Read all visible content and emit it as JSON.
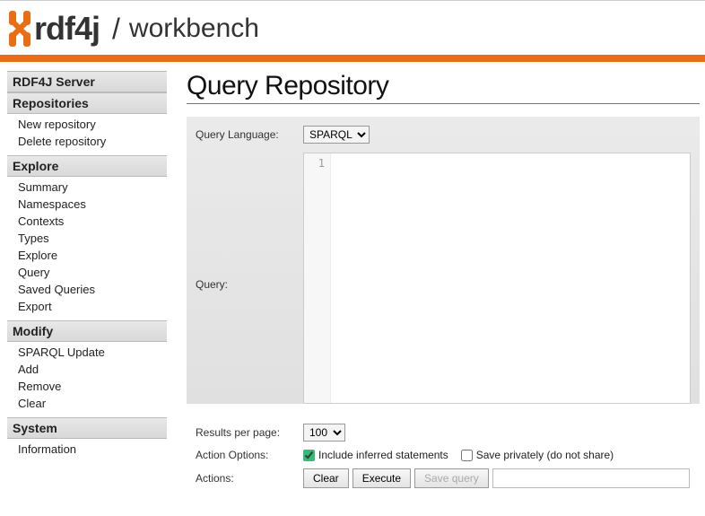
{
  "header": {
    "brand": "rdf4j",
    "slash": "/",
    "suffix": "workbench"
  },
  "sidebar": [
    {
      "title": "RDF4J Server",
      "items": []
    },
    {
      "title": "Repositories",
      "items": [
        "New repository",
        "Delete repository"
      ]
    },
    {
      "title": "Explore",
      "items": [
        "Summary",
        "Namespaces",
        "Contexts",
        "Types",
        "Explore",
        "Query",
        "Saved Queries",
        "Export"
      ]
    },
    {
      "title": "Modify",
      "items": [
        "SPARQL Update",
        "Add",
        "Remove",
        "Clear"
      ]
    },
    {
      "title": "System",
      "items": [
        "Information"
      ]
    }
  ],
  "page": {
    "title": "Query Repository",
    "query_language_label": "Query Language:",
    "query_language_value": "SPARQL",
    "query_label": "Query:",
    "query_text": "",
    "line_number": "1",
    "results_per_page_label": "Results per page:",
    "results_per_page_value": "100",
    "action_options_label": "Action Options:",
    "include_inferred_label": "Include inferred statements",
    "include_inferred_checked": true,
    "save_privately_label": "Save privately (do not share)",
    "save_privately_checked": false,
    "actions_label": "Actions:",
    "clear_btn": "Clear",
    "execute_btn": "Execute",
    "save_query_btn": "Save query",
    "query_name_value": ""
  }
}
